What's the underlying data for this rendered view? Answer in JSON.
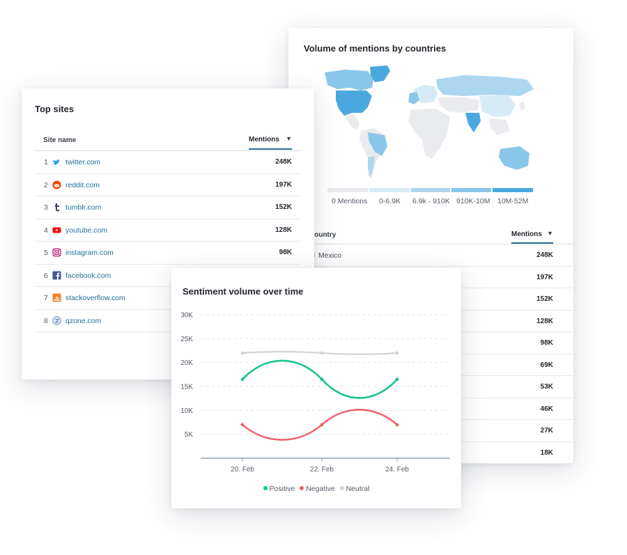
{
  "map_card": {
    "title": "Volume of mentions by countries",
    "legend": [
      {
        "label": "0 Mentions",
        "color": "#e9ebee"
      },
      {
        "label": "0-6.9K",
        "color": "#d5ebf7"
      },
      {
        "label": "6.9k - 910K",
        "color": "#acd7ef"
      },
      {
        "label": "910K-10M",
        "color": "#8ac6ea"
      },
      {
        "label": "10M-52M",
        "color": "#4aa8df"
      }
    ],
    "table": {
      "col_country": "Country",
      "col_mentions": "Mentions",
      "sort_arrow": "▼",
      "rows": [
        {
          "country": "Mexico",
          "mentions": "248K"
        },
        {
          "country": "",
          "mentions": "197K"
        },
        {
          "country": "",
          "mentions": "152K"
        },
        {
          "country": "",
          "mentions": "128K"
        },
        {
          "country": "",
          "mentions": "98K"
        },
        {
          "country": "",
          "mentions": "69K"
        },
        {
          "country": "",
          "mentions": "53K"
        },
        {
          "country": "",
          "mentions": "46K"
        },
        {
          "country": "",
          "mentions": "27K"
        },
        {
          "country": "",
          "mentions": "18K"
        }
      ]
    }
  },
  "sites_card": {
    "title": "Top sites",
    "col_site": "Site name",
    "col_mentions": "Mentions",
    "sort_arrow": "▼",
    "rows": [
      {
        "rank": "1",
        "site": "twitter.com",
        "mentions": "248K",
        "icon": "twitter-icon",
        "color": "#1da1f2"
      },
      {
        "rank": "2",
        "site": "reddit.com",
        "mentions": "197K",
        "icon": "reddit-icon",
        "color": "#ff4500"
      },
      {
        "rank": "3",
        "site": "tumblr.com",
        "mentions": "152K",
        "icon": "tumblr-icon",
        "color": "#35465c"
      },
      {
        "rank": "4",
        "site": "youtube.com",
        "mentions": "128K",
        "icon": "youtube-icon",
        "color": "#ff0000"
      },
      {
        "rank": "5",
        "site": "instagram.com",
        "mentions": "98K",
        "icon": "instagram-icon",
        "color": "#c13584"
      },
      {
        "rank": "6",
        "site": "facebook.com",
        "mentions": "",
        "icon": "facebook-icon",
        "color": "#3b5998"
      },
      {
        "rank": "7",
        "site": "stackoverflow.com",
        "mentions": "",
        "icon": "stackoverflow-icon",
        "color": "#f48024"
      },
      {
        "rank": "8",
        "site": "qzone.com",
        "mentions": "",
        "icon": "qzone-icon",
        "color": "#5b7fb8"
      }
    ]
  },
  "sentiment_card": {
    "title": "Sentiment volume over time"
  },
  "chart_data": {
    "type": "line",
    "title": "Sentiment volume over time",
    "x": [
      "20. Feb",
      "22. Feb",
      "24. Feb"
    ],
    "y_ticks": [
      "5K",
      "10K",
      "15K",
      "20K",
      "25K",
      "30K"
    ],
    "ylim": [
      0,
      30000
    ],
    "grid": true,
    "legend_position": "bottom",
    "series": [
      {
        "name": "Positive",
        "color": "#1cc48a",
        "values": [
          16500,
          16500,
          16500
        ]
      },
      {
        "name": "Negative",
        "color": "#f0626a",
        "values": [
          7000,
          7000,
          7000
        ]
      },
      {
        "name": "Neutral",
        "color": "#cfd2d6",
        "values": [
          22000,
          22000,
          22000
        ]
      }
    ]
  }
}
